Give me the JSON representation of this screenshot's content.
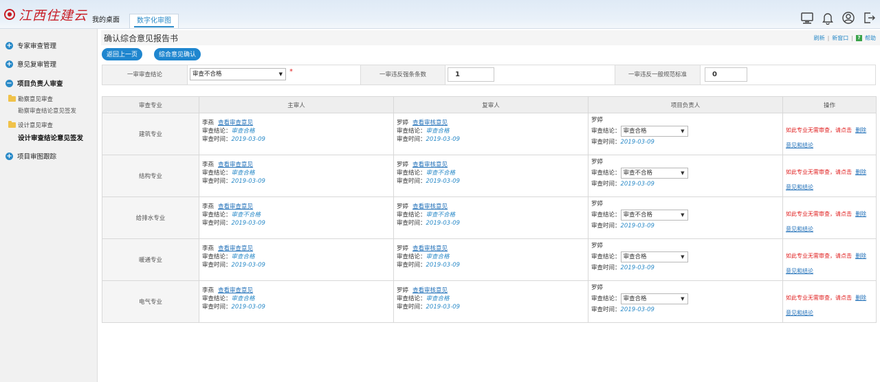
{
  "header": {
    "logo_mark": "●",
    "logo_text": "江西住建云",
    "tabs": [
      {
        "label": "我的桌面"
      },
      {
        "label": "数字化审图"
      }
    ]
  },
  "sidebar": {
    "groups": [
      {
        "label": "专家审查管理"
      },
      {
        "label": "意见复审管理"
      },
      {
        "label": "项目负责人审查"
      },
      {
        "label": "项目审图跟踪"
      }
    ],
    "subs": [
      {
        "label": "勘察意见审查",
        "children": [
          "勘察审查结论意见签发"
        ]
      },
      {
        "label": "设计意见审查",
        "children": [
          "设计审查结论意见签发"
        ]
      }
    ]
  },
  "main": {
    "title": "确认综合意见报告书",
    "links": {
      "refresh": "刷新",
      "new_window": "新窗口",
      "help": "帮助",
      "sep": "|"
    },
    "buttons": {
      "back": "返回上一页",
      "confirm": "综合意见确认"
    },
    "summary": {
      "conclusion_label": "一审审查结论",
      "conclusion_value": "审查不合格",
      "required_mark": "*",
      "strong_label": "一审违反强条条数",
      "strong_value": "1",
      "general_label": "一审违反一般规范标准",
      "general_value": "0"
    },
    "table": {
      "headers": [
        "审查专业",
        "主审人",
        "复审人",
        "项目负责人",
        "操作"
      ],
      "labels": {
        "view_review": "查看审查意见",
        "view_check": "查看审核意见",
        "conclusion": "审查结论：",
        "time": "审查时间：",
        "op_text": "如此专业无需审查，请点击",
        "op_link1": "删除",
        "op_link2": "意见和结论"
      },
      "rows": [
        {
          "spec": "建筑专业",
          "main_name": "李燕",
          "main_result": "审查合格",
          "main_time": "2019-03-09",
          "re_name": "罗婷",
          "re_result": "审查合格",
          "re_time": "2019-03-09",
          "lead_name": "罗婷",
          "lead_result": "审查合格",
          "lead_time": "2019-03-09"
        },
        {
          "spec": "结构专业",
          "main_name": "李燕",
          "main_result": "审查合格",
          "main_time": "2019-03-09",
          "re_name": "罗婷",
          "re_result": "审查不合格",
          "re_time": "2019-03-09",
          "lead_name": "罗婷",
          "lead_result": "审查不合格",
          "lead_time": "2019-03-09"
        },
        {
          "spec": "给排水专业",
          "main_name": "李燕",
          "main_result": "审查不合格",
          "main_time": "2019-03-09",
          "re_name": "罗婷",
          "re_result": "审查不合格",
          "re_time": "2019-03-09",
          "lead_name": "罗婷",
          "lead_result": "审查不合格",
          "lead_time": "2019-03-09"
        },
        {
          "spec": "暖通专业",
          "main_name": "李燕",
          "main_result": "审查合格",
          "main_time": "2019-03-09",
          "re_name": "罗婷",
          "re_result": "审查合格",
          "re_time": "2019-03-09",
          "lead_name": "罗婷",
          "lead_result": "审查合格",
          "lead_time": "2019-03-09"
        },
        {
          "spec": "电气专业",
          "main_name": "李燕",
          "main_result": "审查合格",
          "main_time": "2019-03-09",
          "re_name": "罗婷",
          "re_result": "审查合格",
          "re_time": "2019-03-09",
          "lead_name": "罗婷",
          "lead_result": "审查合格",
          "lead_time": "2019-03-09"
        }
      ]
    }
  },
  "colors": {
    "accent": "#1f86cf",
    "brand": "#c81d25",
    "warning": "#e02020"
  }
}
